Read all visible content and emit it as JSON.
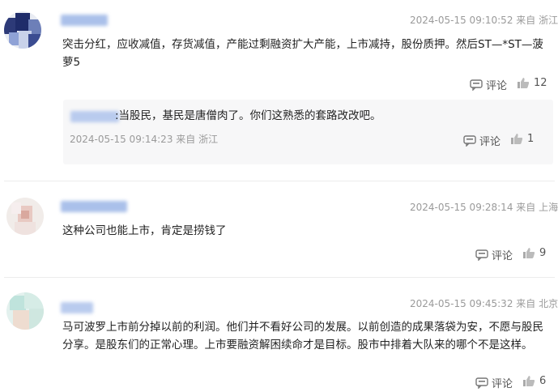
{
  "comments": [
    {
      "meta": "2024-05-15 09:10:52 来自 浙江",
      "text": "突击分红，应收减值，存货减值，产能过剩融资扩大产能，上市减持，股份质押。然后ST—*ST—菠萝5",
      "comment_label": "评论",
      "likes": "12",
      "reply": {
        "text": ":当股民，基民是唐僧肉了。你们这熟悉的套路改改吧。",
        "meta": "2024-05-15 09:14:23   来自 浙江",
        "comment_label": "评论",
        "likes": "1"
      }
    },
    {
      "meta": "2024-05-15 09:28:14 来自 上海",
      "text": "这种公司也能上市，肯定是捞钱了",
      "comment_label": "评论",
      "likes": "9"
    },
    {
      "meta": "2024-05-15 09:45:32 来自 北京",
      "text": "马可波罗上市前分掉以前的利润。他们并不看好公司的发展。以前创造的成果落袋为安，不愿与股民分享。是股东们的正常心理。上市要融资解困续命才是目标。股市中排着大队来的哪个不是这样。",
      "comment_label": "评论",
      "likes": "6"
    }
  ],
  "colors": {
    "name_blur": "#9fb6e6",
    "meta": "#9a9a9a",
    "reply_bg": "#f7f7f8"
  },
  "icons": [
    "comment-icon",
    "thumbs-up-icon"
  ]
}
